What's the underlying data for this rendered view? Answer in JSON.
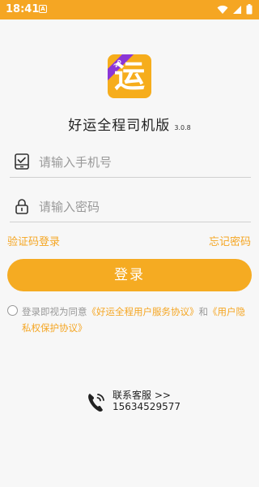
{
  "status_bar": {
    "time": "18:41",
    "notif_glyph": "A",
    "icons": [
      "wifi-icon",
      "signal-icon",
      "battery-icon"
    ]
  },
  "logo": {
    "char": "运",
    "ribbon": "2.0"
  },
  "app": {
    "name": "好运全程司机版",
    "version": "3.0.8"
  },
  "form": {
    "phone_placeholder": "请输入手机号",
    "phone_icon": "phone-card-icon",
    "password_placeholder": "请输入密码",
    "password_icon": "lock-icon"
  },
  "links": {
    "sms_login": "验证码登录",
    "forgot": "忘记密码"
  },
  "login_button": "登录",
  "agreement": {
    "prefix": "登录即视为同意",
    "user_agreement": "《好运全程用户服务协议》",
    "and": "和",
    "privacy": "《用户隐私权保护协议》"
  },
  "service": {
    "label": "联系客服 >>",
    "phone": "15634529577",
    "icon": "phone-icon"
  },
  "colors": {
    "accent": "#f5a623",
    "status_bar": "#f5a623",
    "ribbon": "#8b36d6"
  }
}
